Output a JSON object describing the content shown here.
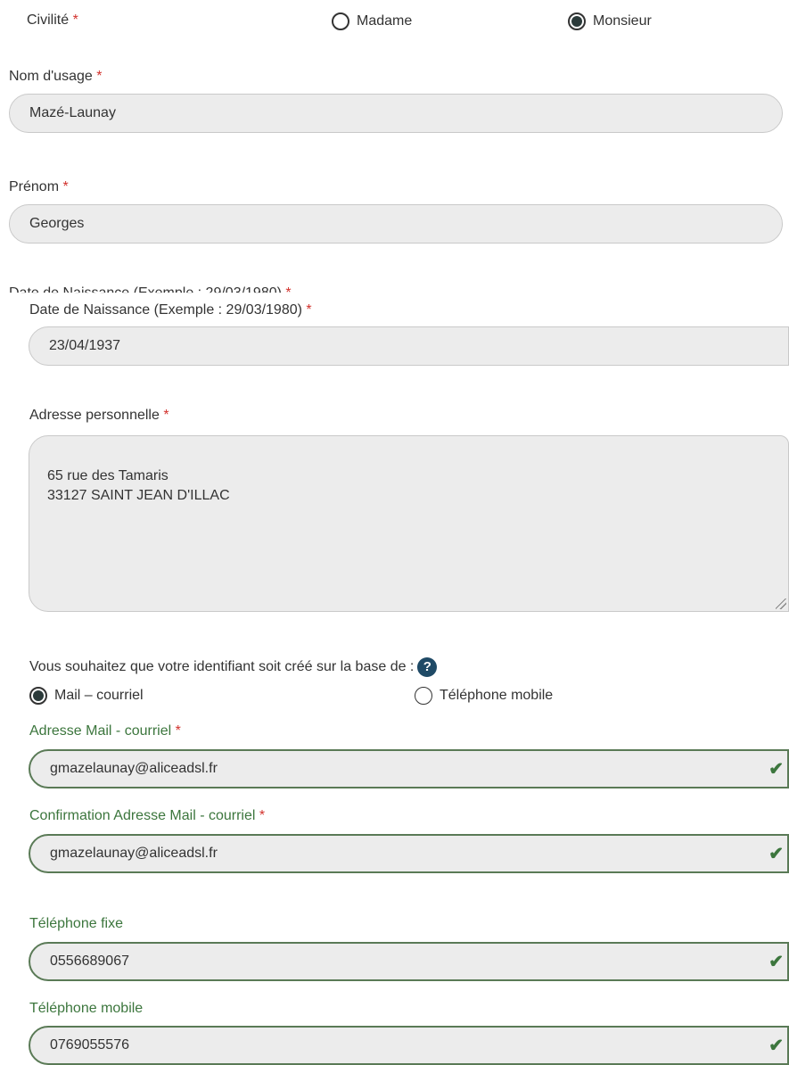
{
  "civilite": {
    "label": "Civilité",
    "required_mark": "*",
    "options": [
      {
        "label": "Madame",
        "selected": false
      },
      {
        "label": "Monsieur",
        "selected": true
      }
    ]
  },
  "nom": {
    "label": "Nom d'usage",
    "required_mark": "*",
    "value": "Mazé-Launay"
  },
  "prenom": {
    "label": "Prénom",
    "required_mark": "*",
    "value": "Georges"
  },
  "naissance": {
    "label": "Date de Naissance (Exemple : 29/03/1980)",
    "required_mark": "*",
    "value": "23/04/1937"
  },
  "adresse": {
    "label": "Adresse personnelle",
    "required_mark": "*",
    "value": "65 rue des Tamaris\n33127 SAINT JEAN D'ILLAC"
  },
  "identifiant": {
    "question": "Vous souhaitez que votre identifiant soit créé sur la base de :",
    "help_icon_glyph": "?",
    "options": [
      {
        "label": "Mail – courriel",
        "selected": true
      },
      {
        "label": "Téléphone mobile",
        "selected": false
      }
    ]
  },
  "mail": {
    "label": "Adresse Mail - courriel",
    "required_mark": "*",
    "value": "gmazelaunay@aliceadsl.fr"
  },
  "mail_confirm": {
    "label": "Confirmation Adresse Mail - courriel",
    "required_mark": "*",
    "value": "gmazelaunay@aliceadsl.fr"
  },
  "tel_fixe": {
    "label": "Téléphone fixe",
    "value": "0556689067"
  },
  "tel_mobile": {
    "label": "Téléphone mobile",
    "value": "0769055576"
  },
  "colors": {
    "valid_green": "#3c763d",
    "required_red": "#d2322d",
    "field_bg": "#ececec",
    "help_icon": "#1f4a66"
  },
  "icons": {
    "valid": "check-icon",
    "help": "help-icon",
    "resize": "resize-grip-icon"
  }
}
